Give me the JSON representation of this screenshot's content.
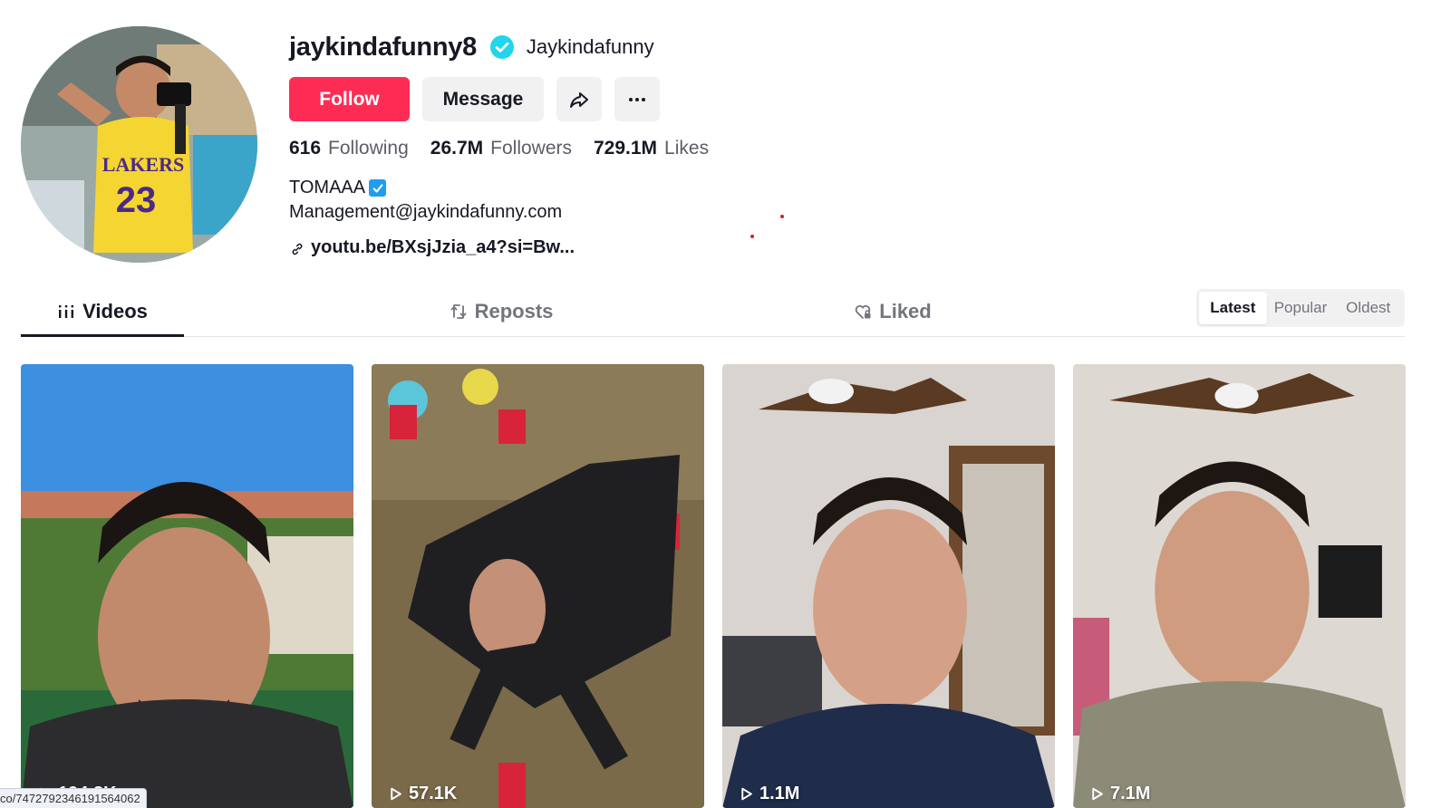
{
  "profile": {
    "username": "jaykindafunny8",
    "nickname": "Jaykindafunny",
    "verified": true,
    "buttons": {
      "follow": "Follow",
      "message": "Message",
      "share_icon": "share-icon",
      "more_icon": "more-icon"
    },
    "stats": [
      {
        "number": "616",
        "label": "Following"
      },
      {
        "number": "26.7M",
        "label": "Followers"
      },
      {
        "number": "729.1M",
        "label": "Likes"
      }
    ],
    "bio": {
      "line1": "TOMAAA",
      "line2": "Management@jaykindafunny.com",
      "link": "youtu.be/BXsjJzia_a4?si=Bw..."
    }
  },
  "tabs": [
    {
      "label": "Videos",
      "icon": "grid-icon",
      "active": true
    },
    {
      "label": "Reposts",
      "icon": "repost-icon",
      "active": false
    },
    {
      "label": "Liked",
      "icon": "heart-lock-icon",
      "active": false
    }
  ],
  "sort": {
    "options": [
      "Latest",
      "Popular",
      "Oldest"
    ],
    "selected": "Latest"
  },
  "videos": [
    {
      "views": "194.8K"
    },
    {
      "views": "57.1K"
    },
    {
      "views": "1.1M"
    },
    {
      "views": "7.1M"
    }
  ],
  "status_url": "co/7472792346191564062",
  "colors": {
    "accent": "#fe2c55",
    "verified": "#20d5ec",
    "text": "#161823",
    "muted": "#73757c"
  }
}
